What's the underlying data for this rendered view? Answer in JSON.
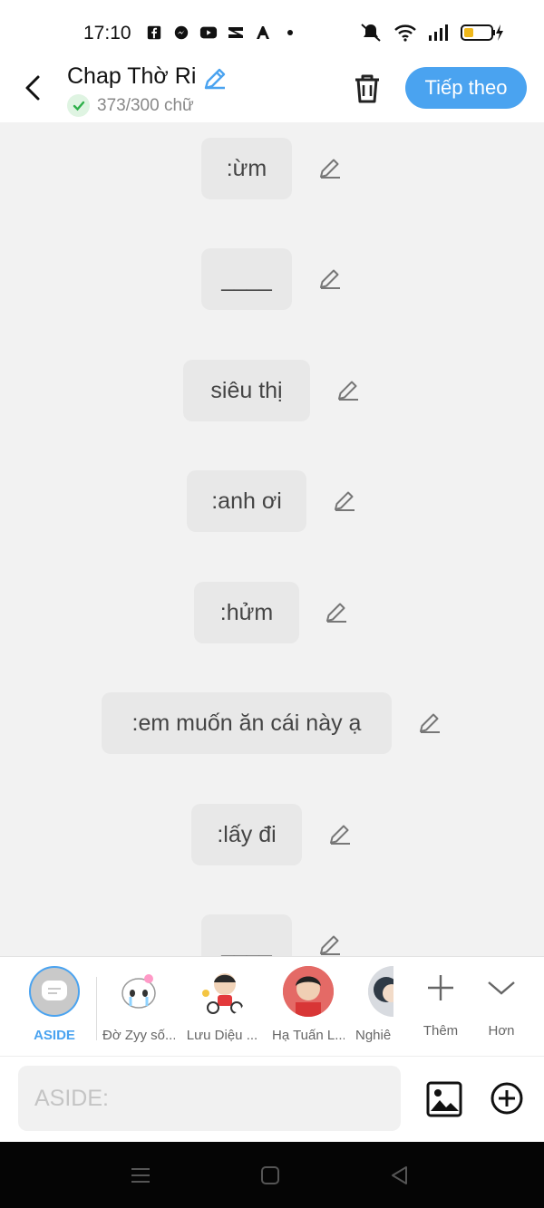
{
  "status_bar": {
    "time": "17:10",
    "notification_icons": [
      "facebook-icon",
      "messenger-icon",
      "youtube-icon",
      "capcut-icon",
      "app-a-icon",
      "dot-icon"
    ],
    "system_icons": [
      "mute-icon",
      "wifi-icon",
      "signal-icon",
      "battery-charging-icon"
    ]
  },
  "header": {
    "title": "Chap Thờ Ri",
    "word_count": "373/300 chữ",
    "next_label": "Tiếp theo"
  },
  "messages": [
    {
      "text": ":ừm"
    },
    {
      "text": "____"
    },
    {
      "text": "siêu thị"
    },
    {
      "text": ":anh ơi"
    },
    {
      "text": ":hửm"
    },
    {
      "text": ":em muốn ăn cái này ạ"
    },
    {
      "text": ":lấy đi"
    },
    {
      "text": "____"
    }
  ],
  "characters": [
    {
      "label": "ASIDE",
      "selected": true
    },
    {
      "label": "Đờ Zyy số..."
    },
    {
      "label": "Lưu Diệu ..."
    },
    {
      "label": "Hạ Tuấn L..."
    },
    {
      "label": "Nghiê"
    },
    {
      "label": "Thêm"
    },
    {
      "label": "Hơn"
    }
  ],
  "input": {
    "placeholder": "ASIDE:"
  },
  "colors": {
    "accent": "#4aa3f0",
    "bubble": "#e8e8e8",
    "background": "#f2f2f2"
  }
}
